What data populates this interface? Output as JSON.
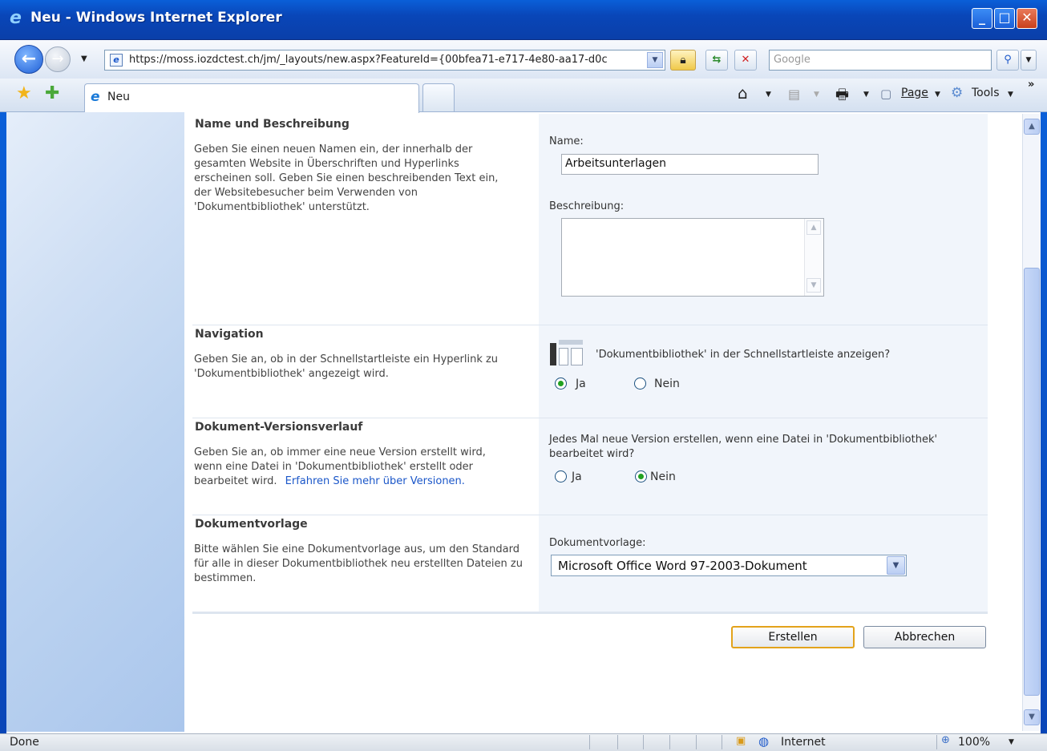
{
  "window": {
    "title": "Neu - Windows Internet Explorer",
    "minimize": "_",
    "maximize": "□",
    "close": "✕"
  },
  "address_bar": {
    "url": "https://moss.iozdctest.ch/jm/_layouts/new.aspx?FeatureId={00bfea71-e717-4e80-aa17-d0c",
    "search_placeholder": "Google"
  },
  "tabs": {
    "active_label": "Neu"
  },
  "command_bar": {
    "page_label": "Page",
    "tools_label": "Tools"
  },
  "sections": {
    "name": {
      "title": "Name und Beschreibung",
      "description": "Geben Sie einen neuen Namen ein, der innerhalb der gesamten Website in Überschriften und Hyperlinks erscheinen soll. Geben Sie einen beschreibenden Text ein, der Websitebesucher beim Verwenden von 'Dokumentbibliothek' unterstützt.",
      "name_label": "Name:",
      "name_value": "Arbeitsunterlagen",
      "desc_label": "Beschreibung:",
      "desc_value": ""
    },
    "navigation": {
      "title": "Navigation",
      "description": "Geben Sie an, ob in der Schnellstartleiste ein Hyperlink zu 'Dokumentbibliothek' angezeigt wird.",
      "question": "'Dokumentbibliothek' in der Schnellstartleiste anzeigen?",
      "yes": "Ja",
      "no": "Nein",
      "selected": "Ja"
    },
    "versioning": {
      "title": "Dokument-Versionsverlauf",
      "description": "Geben Sie an, ob immer eine neue Version erstellt wird, wenn eine Datei in 'Dokumentbibliothek' erstellt oder bearbeitet wird.",
      "link": "Erfahren Sie mehr über Versionen.",
      "question": "Jedes Mal neue Version erstellen, wenn eine Datei in 'Dokumentbibliothek' bearbeitet wird?",
      "yes": "Ja",
      "no": "Nein",
      "selected": "Nein"
    },
    "template": {
      "title": "Dokumentvorlage",
      "description": "Bitte wählen Sie eine Dokumentvorlage aus, um den Standard für alle in dieser Dokumentbibliothek neu erstellten Dateien zu bestimmen.",
      "label": "Dokumentvorlage:",
      "selected": "Microsoft Office Word 97-2003-Dokument"
    }
  },
  "buttons": {
    "create": "Erstellen",
    "cancel": "Abbrechen"
  },
  "status_bar": {
    "status": "Done",
    "zone": "Internet",
    "zoom": "100%"
  }
}
